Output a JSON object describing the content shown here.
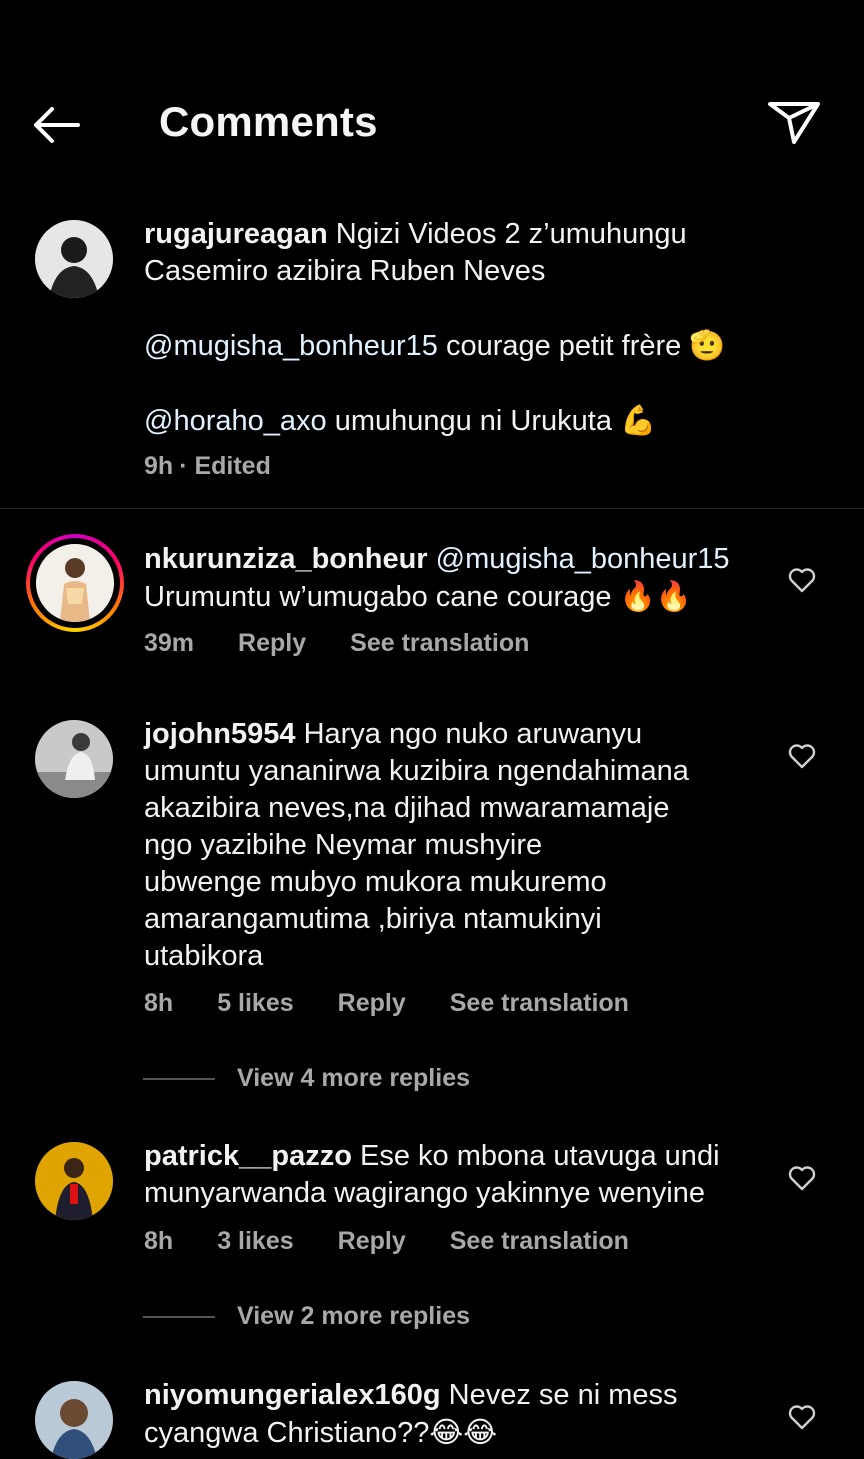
{
  "header": {
    "title": "Comments"
  },
  "caption": {
    "username": "rugajureagan",
    "line1": "Ngizi Videos 2 z’umuhungu",
    "line2": "Casemiro azibira Ruben Neves",
    "mention1": "@mugisha_bonheur15",
    "text1": "courage petit frère",
    "emoji1": "🫡",
    "mention2": "@horaho_axo",
    "text2": "umuhungu ni Urukuta",
    "emoji2": "💪",
    "time": "9h",
    "edited": "· Edited"
  },
  "comments": [
    {
      "username": "nkurunziza_bonheur",
      "mention": "@mugisha_bonheur15",
      "text": "Urumuntu w’umugabo cane courage",
      "emoji": "🔥🔥",
      "time": "39m",
      "reply": "Reply",
      "translate": "See translation"
    },
    {
      "username": "jojohn5954",
      "lines": [
        "Harya ngo nuko aruwanyu",
        "umuntu yananirwa kuzibira ngendahimana",
        "akazibira neves,na djihad mwaramamaje",
        "ngo yazibihe Neymar mushyire",
        "ubwenge mubyo mukora mukuremo",
        "amarangamutima ,biriya ntamukinyi",
        "utabikora"
      ],
      "time": "8h",
      "likes": "5 likes",
      "reply": "Reply",
      "translate": "See translation",
      "view_more": "View 4 more replies"
    },
    {
      "username": "patrick__pazzo",
      "lines": [
        "Ese ko mbona utavuga undi",
        "munyarwanda wagirango yakinnye wenyine"
      ],
      "time": "8h",
      "likes": "3 likes",
      "reply": "Reply",
      "translate": "See translation",
      "view_more": "View 2 more replies"
    },
    {
      "username": "niyomungerialex160g",
      "lines": [
        "Nevez se ni mess",
        "cyangwa Christiano??"
      ],
      "emoji": "😂😂"
    }
  ],
  "colors": {
    "background": "#000000",
    "text": "#f5f5f5",
    "muted": "#a8a8a8",
    "mention": "#e0f1ff"
  }
}
